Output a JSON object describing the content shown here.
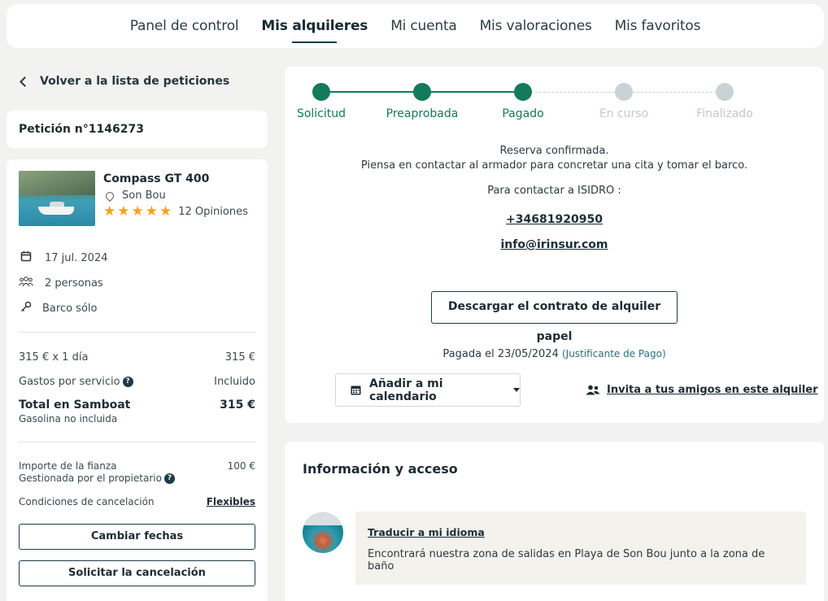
{
  "nav": {
    "tabs": [
      {
        "label": "Panel de control",
        "active": false
      },
      {
        "label": "Mis alquileres",
        "active": true
      },
      {
        "label": "Mi cuenta",
        "active": false
      },
      {
        "label": "Mis valoraciones",
        "active": false
      },
      {
        "label": "Mis favoritos",
        "active": false
      }
    ]
  },
  "sidebar": {
    "back_label": "Volver a la lista de peticiones",
    "request_label": "Petición n°1146273",
    "boat": {
      "name": "Compass GT 400",
      "location": "Son Bou",
      "rating_stars": 5,
      "reviews": "12 Opiniones"
    },
    "date": "17 jul. 2024",
    "people": "2 personas",
    "mode": "Barco sólo",
    "price_line_label": "315 € x 1 día",
    "price_line_value": "315 €",
    "service_label": "Gastos por servicio",
    "service_value": "Incluido",
    "total_label": "Total en Samboat",
    "total_value": "315 €",
    "fuel_note": "Gasolina no incluida",
    "deposit_label": "Importe de la fianza",
    "deposit_sub": "Gestionada por el propietario",
    "deposit_value": "100 €",
    "cancel_cond_label": "Condiciones de cancelación",
    "cancel_cond_value": "Flexibles",
    "change_dates_btn": "Cambiar fechas",
    "request_cancel_btn": "Solicitar la cancelación"
  },
  "main": {
    "steps": [
      {
        "label": "Solicitud",
        "done": true
      },
      {
        "label": "Preaprobada",
        "done": true
      },
      {
        "label": "Pagado",
        "done": true
      },
      {
        "label": "En curso",
        "done": false
      },
      {
        "label": "Finalizado",
        "done": false
      }
    ],
    "confirmed": "Reserva confirmada.",
    "contact_hint": "Piensa en contactar al armador para concretar una cita y tomar el barco.",
    "contact_to": "Para contactar a ISIDRO :",
    "phone": "+34681920950",
    "email": "info@irinsur.com",
    "download_btn": "Descargar el contrato de alquiler papel",
    "paid_text": "Pagada el 23/05/2024",
    "receipt_link": "(Justificante de Pago)",
    "calendar_btn": "Añadir a mi calendario",
    "invite_link": "Invita a tus amigos en este alquiler"
  },
  "info": {
    "title": "Información y acceso",
    "translate_link": "Traducir a mi idioma",
    "message": "Encontrará nuestra zona de salidas en Playa de Son Bou junto a la zona de baño"
  },
  "colors": {
    "accent": "#137a5a",
    "pending": "#c9d3d6",
    "pending_text": "#c2c9cc"
  }
}
